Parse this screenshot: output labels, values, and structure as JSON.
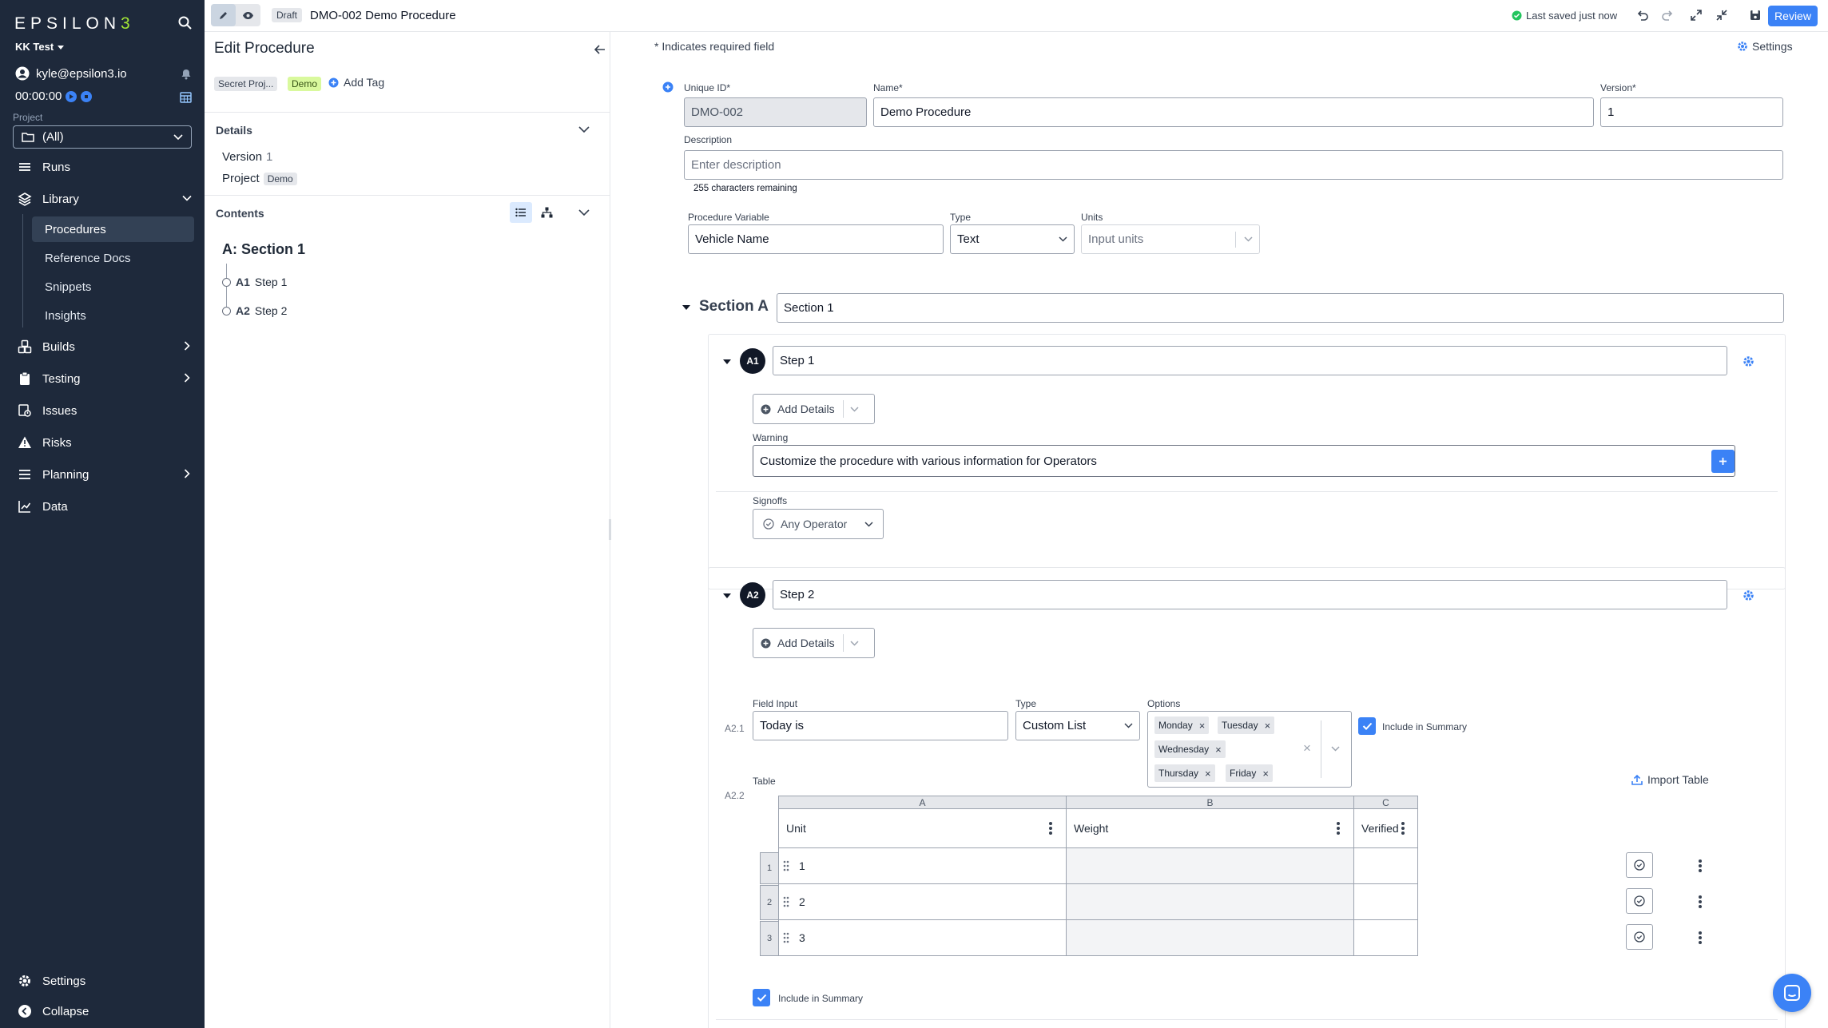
{
  "sidebar": {
    "logo_text": "EPSILON",
    "logo_accent": "3",
    "workspace": "KK Test",
    "user_email": "kyle@epsilon3.io",
    "timer": "00:00:00",
    "project_label": "Project",
    "project_value": "(All)",
    "nav": {
      "runs": "Runs",
      "library": "Library",
      "builds": "Builds",
      "testing": "Testing",
      "issues": "Issues",
      "risks": "Risks",
      "planning": "Planning",
      "data": "Data",
      "settings": "Settings",
      "collapse": "Collapse"
    },
    "library_items": [
      "Procedures",
      "Reference Docs",
      "Snippets",
      "Insights"
    ]
  },
  "topbar": {
    "status": "Draft",
    "title": "DMO-002 Demo Procedure",
    "saved": "Last saved just now",
    "review": "Review"
  },
  "edit_panel": {
    "title": "Edit Procedure",
    "tags": [
      "Secret Proj...",
      "Demo"
    ],
    "add_tag": "Add Tag",
    "details_heading": "Details",
    "version_label": "Version",
    "version_value": "1",
    "project_label": "Project",
    "project_value": "Demo",
    "contents_heading": "Contents",
    "section_title": "A: Section 1",
    "steps": [
      {
        "id": "A1",
        "name": "Step 1"
      },
      {
        "id": "A2",
        "name": "Step 2"
      }
    ]
  },
  "main": {
    "required_note": "* Indicates required field",
    "settings": "Settings",
    "unique_id_label": "Unique ID*",
    "unique_id": "DMO-002",
    "name_label": "Name*",
    "name": "Demo Procedure",
    "version_label": "Version*",
    "version": "1",
    "description_label": "Description",
    "description_placeholder": "Enter description",
    "chars_remaining": "255 characters remaining",
    "proc_var_label": "Procedure Variable",
    "proc_var": "Vehicle Name",
    "type_label": "Type",
    "type": "Text",
    "units_label": "Units",
    "units_placeholder": "Input units",
    "section_label": "Section A",
    "section_name": "Section 1",
    "step1": {
      "badge": "A1",
      "name": "Step 1",
      "add_details": "Add Details",
      "warning_label": "Warning",
      "warning_text": "Customize the procedure with various information for Operators",
      "signoffs_label": "Signoffs",
      "signoff": "Any Operator"
    },
    "step2": {
      "badge": "A2",
      "name": "Step 2",
      "add_details": "Add Details",
      "field_num": "A2.1",
      "field_input_label": "Field Input",
      "field_input": "Today is",
      "type_label": "Type",
      "type": "Custom List",
      "options_label": "Options",
      "options": [
        "Monday",
        "Tuesday",
        "Wednesday",
        "Thursday",
        "Friday"
      ],
      "include_summary": "Include in Summary",
      "table_num": "A2.2",
      "table_label": "Table",
      "import_table": "Import Table",
      "col_letters": [
        "A",
        "B",
        "C"
      ],
      "col_headers": [
        "Unit",
        "Weight",
        "Verified"
      ],
      "row_numbers": [
        "1",
        "2",
        "3"
      ],
      "rows": [
        "1",
        "2",
        "3"
      ],
      "table_include_summary": "Include in Summary"
    }
  },
  "colors": {
    "sidebar_bg": "#1e293b",
    "accent": "#3b82f6",
    "logo_accent": "#a3e635",
    "tag_green": "#d9f99d",
    "saved_green": "#22c55e"
  }
}
